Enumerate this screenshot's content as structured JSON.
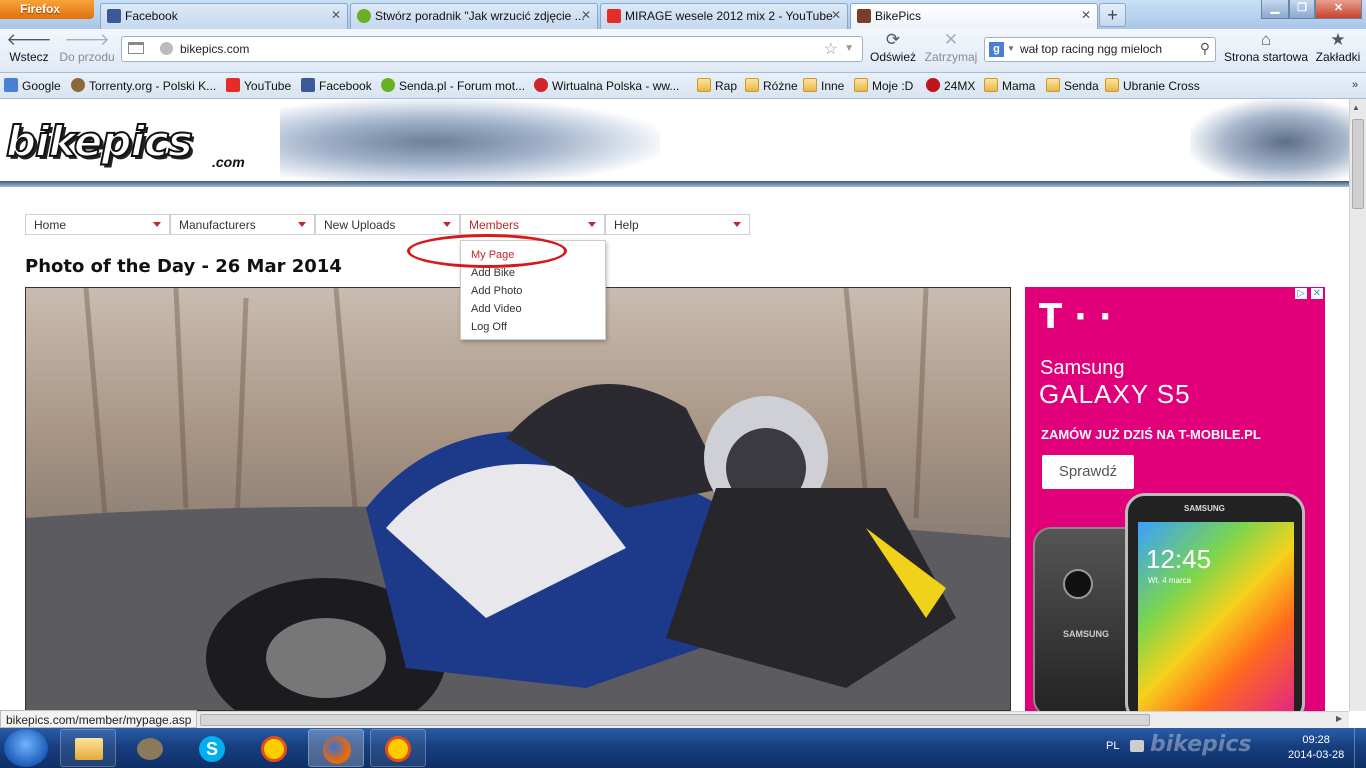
{
  "browser": {
    "menu_button": "Firefox",
    "tabs": [
      {
        "label": "Facebook",
        "icon": "facebook-icon",
        "color": "#3b5998"
      },
      {
        "label": "Stwórz poradnik \"Jak wrzucić zdjęcie ...",
        "icon": "senda-icon",
        "color": "#6ab023"
      },
      {
        "label": "MIRAGE wesele 2012 mix 2 - YouTube",
        "icon": "youtube-icon",
        "color": "#e52d27"
      },
      {
        "label": "BikePics",
        "icon": "bikepics-icon",
        "color": "#7b3c2a"
      }
    ],
    "nav": {
      "back": "Wstecz",
      "forward": "Do przodu",
      "reload": "Odśwież",
      "stop": "Zatrzymaj",
      "home": "Strona startowa",
      "bookmarks": "Zakładki"
    },
    "url": "bikepics.com",
    "search_value": "wał top racing ngg mieloch",
    "bookmarks": [
      {
        "label": "Google",
        "icon": "google-icon",
        "color": "#4a7fd6"
      },
      {
        "label": "Torrenty.org - Polski K...",
        "icon": "torrent-icon",
        "color": "#8b6a3a"
      },
      {
        "label": "YouTube",
        "icon": "youtube-icon",
        "color": "#e52d27"
      },
      {
        "label": "Facebook",
        "icon": "facebook-icon",
        "color": "#3b5998"
      },
      {
        "label": "Senda.pl - Forum mot...",
        "icon": "senda-icon",
        "color": "#6ab023"
      },
      {
        "label": "Wirtualna Polska - ww...",
        "icon": "wp-icon",
        "color": "#d2232a"
      },
      {
        "label": "Rap",
        "icon": "folder-icon"
      },
      {
        "label": "Różne",
        "icon": "folder-icon"
      },
      {
        "label": "Inne",
        "icon": "folder-icon"
      },
      {
        "label": "Moje :D",
        "icon": "folder-icon"
      },
      {
        "label": "24MX",
        "icon": "24mx-icon",
        "color": "#c0141a"
      },
      {
        "label": "Mama",
        "icon": "folder-icon"
      },
      {
        "label": "Senda",
        "icon": "folder-icon"
      },
      {
        "label": "Ubranie Cross",
        "icon": "folder-icon"
      }
    ],
    "status_url": "bikepics.com/member/mypage.asp"
  },
  "site": {
    "logo": "bikepics",
    "logo_sub": ".com",
    "menu": [
      {
        "label": "Home"
      },
      {
        "label": "Manufacturers"
      },
      {
        "label": "New Uploads"
      },
      {
        "label": "Members"
      },
      {
        "label": "Help"
      }
    ],
    "dropdown": [
      "My Page",
      "Add Bike",
      "Add Photo",
      "Add Video",
      "Log Off"
    ],
    "photo_of_day": "Photo of the Day - 26 Mar 2014"
  },
  "ad": {
    "brand": "T · ·",
    "line1": "Samsung",
    "line2": "GALAXY S5",
    "line3": "ZAMÓW JUŻ DZIŚ NA T-MOBILE.PL",
    "button": "Sprawdź",
    "phone_brand": "SAMSUNG",
    "phone_time": "12:45",
    "phone_date": "Wt. 4 marca"
  },
  "taskbar": {
    "lang": "PL",
    "time": "09:28",
    "date": "2014-03-28"
  }
}
